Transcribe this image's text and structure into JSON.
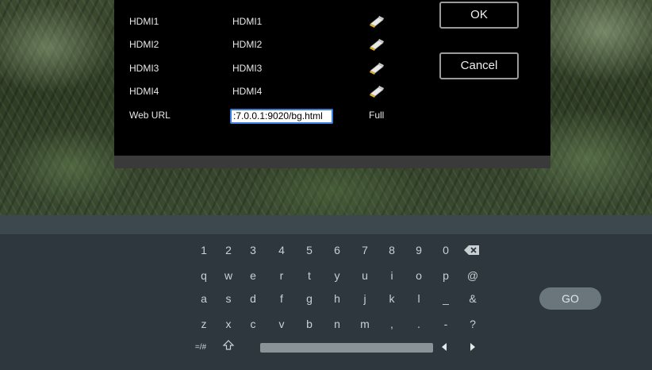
{
  "dialog": {
    "rows": [
      {
        "name": "HDMI1",
        "source": "HDMI1",
        "icon": "hdmi-cable-icon"
      },
      {
        "name": "HDMI2",
        "source": "HDMI2",
        "icon": "hdmi-cable-icon"
      },
      {
        "name": "HDMI3",
        "source": "HDMI3",
        "icon": "hdmi-cable-icon"
      },
      {
        "name": "HDMI4",
        "source": "HDMI4",
        "icon": "hdmi-cable-icon"
      }
    ],
    "web_url": {
      "label": "Web URL",
      "value": ":7.0.0.1:9020/bg.html",
      "mode": "Full"
    },
    "ok_label": "OK",
    "cancel_label": "Cancel"
  },
  "keyboard": {
    "row1": [
      "1",
      "2",
      "3",
      "4",
      "5",
      "6",
      "7",
      "8",
      "9",
      "0"
    ],
    "row2": [
      "q",
      "w",
      "e",
      "r",
      "t",
      "y",
      "u",
      "i",
      "o",
      "p",
      "@"
    ],
    "row3": [
      "a",
      "s",
      "d",
      "f",
      "g",
      "h",
      "j",
      "k",
      "l",
      "_",
      "&"
    ],
    "row4": [
      "z",
      "x",
      "c",
      "v",
      "b",
      "n",
      "m",
      ",",
      ".",
      "-",
      "?"
    ],
    "symbols_label": "=/#",
    "go_label": "GO",
    "backspace_icon": "backspace-icon",
    "shift_icon": "shift-icon",
    "left_icon": "arrow-left-icon",
    "right_icon": "arrow-right-icon"
  },
  "colors": {
    "focus_border": "#3a7fe0",
    "keyboard_bg": "#2d373d",
    "dialog_bg": "#000000"
  }
}
